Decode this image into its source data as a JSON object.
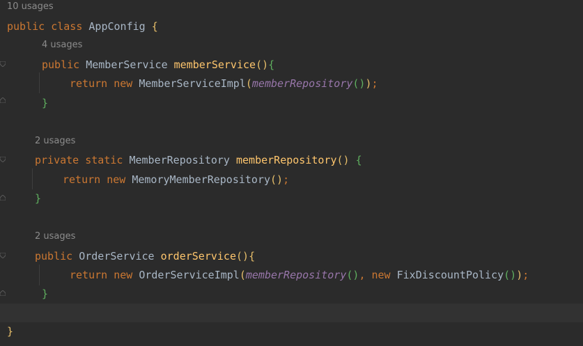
{
  "hints": {
    "class_usages": "10 usages",
    "member_service_usages": "4 usages",
    "member_repository_usages": "2 usages",
    "order_service_usages": "2 usages"
  },
  "tokens": {
    "public": "public",
    "class": "class",
    "private": "private",
    "static": "static",
    "return": "return",
    "new": "new",
    "class_name": "AppConfig",
    "member_service_type": "MemberService",
    "member_service_fn": "memberService",
    "member_service_impl": "MemberServiceImpl",
    "member_repository_type": "MemberRepository",
    "member_repository_fn": "memberRepository",
    "memory_member_repository": "MemoryMemberRepository",
    "order_service_type": "OrderService",
    "order_service_fn": "orderService",
    "order_service_impl": "OrderServiceImpl",
    "fix_discount_policy": "FixDiscountPolicy"
  },
  "colors": {
    "background": "#2b2b2b",
    "keyword": "#cc7832",
    "method": "#ffc66d",
    "identifier": "#a9b7c6",
    "italic_call": "#9876aa",
    "hint": "#8c8c8c"
  }
}
